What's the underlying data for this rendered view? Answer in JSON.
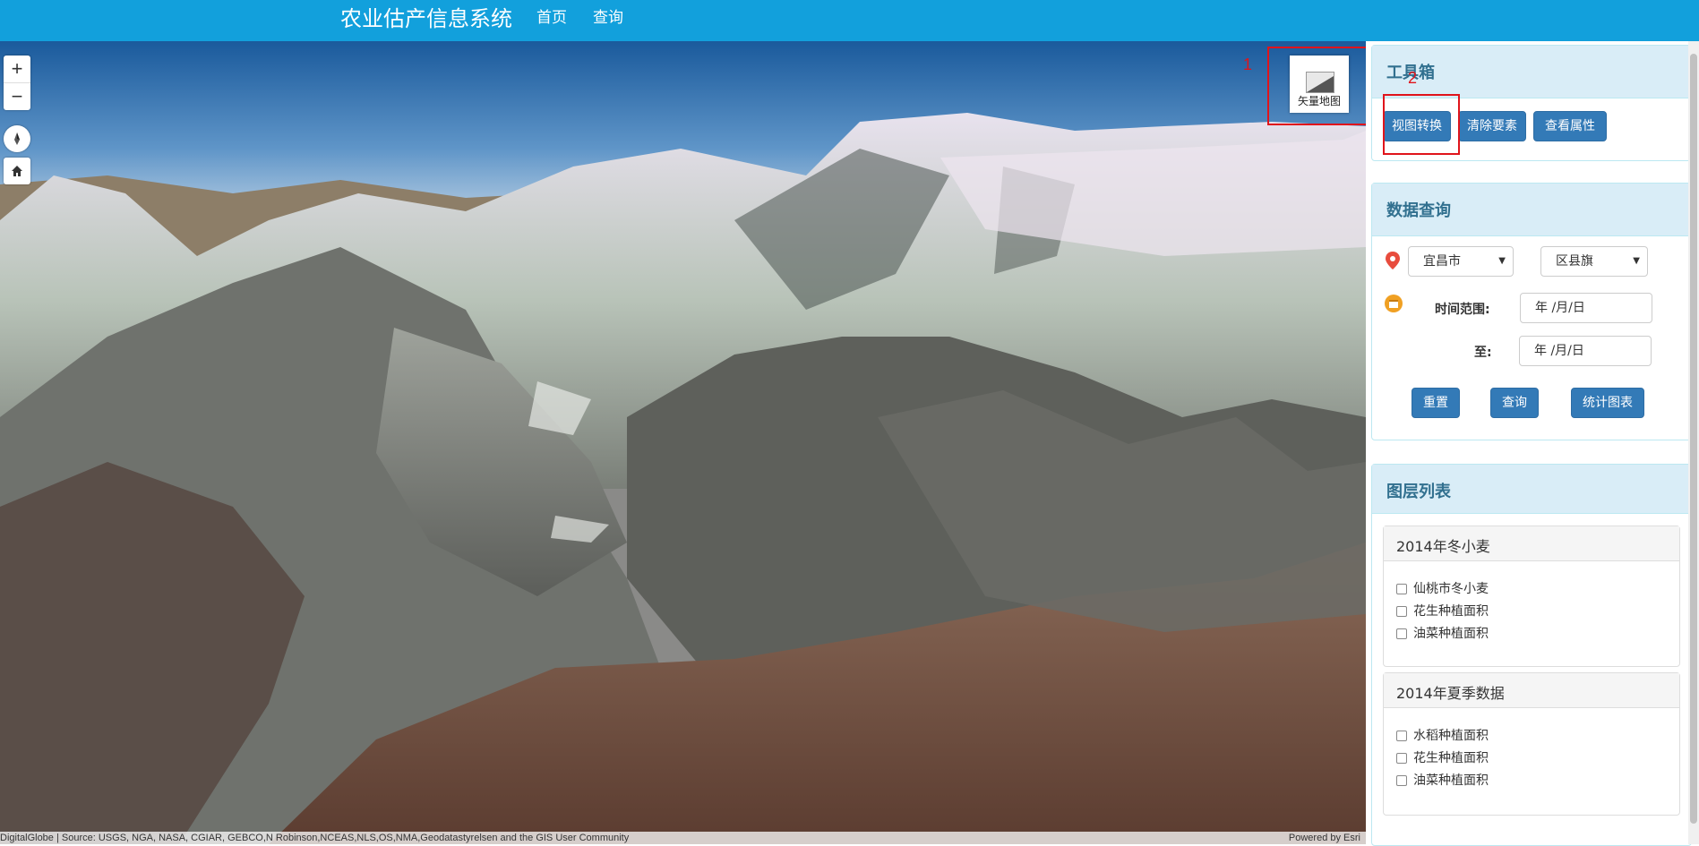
{
  "header": {
    "app_title": "农业估产信息系统",
    "nav": [
      {
        "label": "首页"
      },
      {
        "label": "查询"
      }
    ]
  },
  "map": {
    "zoom_in": "+",
    "zoom_out": "−",
    "icons": {
      "compass": "compass-icon",
      "home": "home-icon"
    },
    "basemap_toggle_label": "矢量地图",
    "annotations": [
      "1",
      "2"
    ],
    "attribution_left": "DigitalGlobe | Source: USGS, NGA, NASA, CGIAR, GEBCO,N Robinson,NCEAS,NLS,OS,NMA,Geodatastyrelsen and the GIS User Community",
    "attribution_right": "Powered by Esri"
  },
  "toolbox": {
    "title": "工具箱",
    "buttons": [
      {
        "label": "视图转换"
      },
      {
        "label": "清除要素"
      },
      {
        "label": "查看属性"
      }
    ]
  },
  "query": {
    "title": "数据查询",
    "city_select": "宜昌市",
    "district_select": "区县旗",
    "time_range_label": "时间范围:",
    "to_label": "至:",
    "date_from": "年 /月/日",
    "date_to": "年 /月/日",
    "buttons": [
      {
        "label": "重置"
      },
      {
        "label": "查询"
      },
      {
        "label": "统计图表"
      }
    ],
    "icon_colors": {
      "location": "#e84c3d",
      "calendar": "#f0a023"
    }
  },
  "layers": {
    "title": "图层列表",
    "groups": [
      {
        "title": "2014年冬小麦",
        "items": [
          {
            "label": "仙桃市冬小麦"
          },
          {
            "label": "花生种植面积"
          },
          {
            "label": "油菜种植面积"
          }
        ]
      },
      {
        "title": "2014年夏季数据",
        "items": [
          {
            "label": "水稻种植面积"
          },
          {
            "label": "花生种植面积"
          },
          {
            "label": "油菜种植面积"
          }
        ]
      }
    ]
  },
  "colors": {
    "header_bg": "#12a0dc",
    "primary_button": "#337ab7",
    "panel_heading_bg": "#d9edf7",
    "panel_title": "#31708f",
    "annotation_red": "#e0141b"
  }
}
